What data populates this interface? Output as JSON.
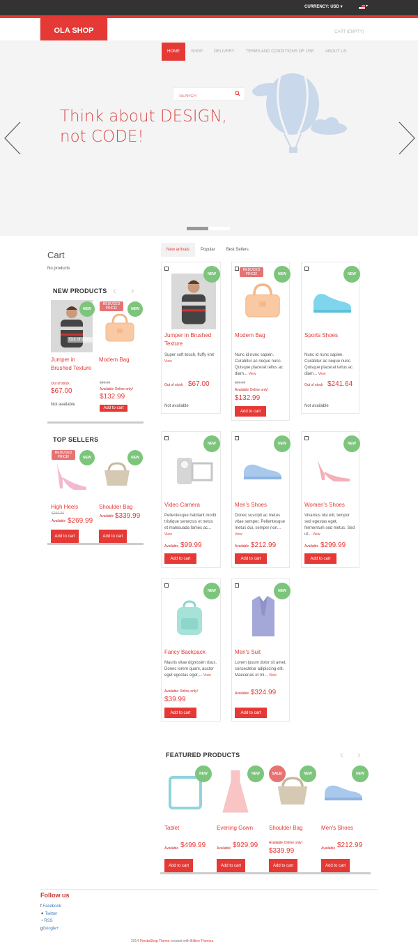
{
  "header": {
    "currency": "CURRENCY: USD",
    "logo": "OLA SHOP",
    "cart_status": "CART (EMPTY)"
  },
  "nav": {
    "items": [
      "HOME",
      "SHOP",
      "DELIVERY",
      "TERMS AND CONDITIONS OF USE",
      "ABOUT US"
    ],
    "active": "HOME"
  },
  "hero": {
    "search_placeholder": "SEARCH",
    "tagline_line1": "Think about DESIGN,",
    "tagline_line2": "not CODE!"
  },
  "sidebar": {
    "cart_title": "Cart",
    "cart_empty": "No products",
    "new_products_title": "NEW PRODUCTS",
    "new_products": [
      {
        "name": "Jumper in Brushed Texture",
        "badge": "NEW",
        "overlay": "Out of stock",
        "stock": "Out of stock",
        "price": "$67.00",
        "status": "Not available"
      },
      {
        "name": "Modern Bag",
        "badge": "NEW",
        "tag": "REDUCED PRICE!",
        "old_price": "$99.99",
        "availability": "Available Online only!",
        "price": "$132.99",
        "button": "Add to cart"
      }
    ],
    "top_sellers_title": "TOP SELLERS",
    "top_sellers": [
      {
        "name": "High Heels",
        "badge": "NEW",
        "tag": "REDUCED PRICE!",
        "old_price": "$299.99",
        "availability": "Available",
        "price": "$269.99",
        "button": "Add to cart"
      },
      {
        "name": "Shoulder Bag",
        "badge": "NEW",
        "availability": "Available",
        "price": "$339.99",
        "button": "Add to cart"
      }
    ]
  },
  "tabs": [
    "New arrivals",
    "Popular",
    "Best Sellers"
  ],
  "products": [
    {
      "name": "Jumper in Brushed Texture",
      "badge": "NEW",
      "desc": "Super soft-touch, fluffy knit",
      "view": "View",
      "stock": "Out of stock",
      "price": "$67.00",
      "status": "Not available"
    },
    {
      "name": "Modern Bag",
      "badge": "NEW",
      "tag": "REDUCED PRICE!",
      "desc": "Nunc id nunc sapien. Curabitur ac neque nunc. Quisque placerat tellus ac diam...",
      "view": "View",
      "old_price": "$99.99",
      "availability": "Available Online only!",
      "price": "$132.99",
      "button": "Add to cart"
    },
    {
      "name": "Sports Shoes",
      "badge": "NEW",
      "desc": "Nunc id nunc sapien. Curabitur ac neque nunc. Quisque placerat tellus ac diam...",
      "view": "View",
      "stock": "Out of stock",
      "price": "$241.64",
      "status": "Not available"
    },
    {
      "name": "Video Camera",
      "badge": "NEW",
      "desc": "Pellentesque habitant morbi tristique senectus et netus et malesuada fames ac...",
      "view": "View",
      "availability": "Available",
      "price": "$99.99",
      "button": "Add to cart"
    },
    {
      "name": "Men's Shoes",
      "badge": "NEW",
      "desc": "Donec suscipit ac metus vitae semper. Pellentesque metus dui, semper non...",
      "view": "View",
      "availability": "Available",
      "price": "$212.99",
      "button": "Add to cart"
    },
    {
      "name": "Women's Shoes",
      "badge": "NEW",
      "desc": "Vivamus nisi elit, tempor sed egestas eget, fermentum sed metus. Sed ut...",
      "view": "View",
      "availability": "Available",
      "price": "$299.99",
      "button": "Add to cart"
    },
    {
      "name": "Fancy Backpack",
      "badge": "NEW",
      "desc": "Mauris vitae dignissim risus. Donec lorem quam, auctor eget egestas eget,...",
      "view": "View",
      "availability": "Available Online only!",
      "price": "$39.99",
      "button": "Add to cart"
    },
    {
      "name": "Men's Suit",
      "badge": "NEW",
      "desc": "Lorem ipsum dolor sit amet, consectetur adipiscing elit. Maecenas et mi...",
      "view": "View",
      "availability": "Available",
      "price": "$324.99",
      "button": "Add to cart"
    }
  ],
  "featured": {
    "title": "FEATURED PRODUCTS",
    "items": [
      {
        "name": "Tablet",
        "badge": "NEW",
        "availability": "Available",
        "price": "$499.99",
        "button": "Add to cart"
      },
      {
        "name": "Evening Gown",
        "badge": "NEW",
        "availability": "Available",
        "price": "$929.99",
        "button": "Add to cart"
      },
      {
        "name": "Shoulder Bag",
        "badge": "NEW",
        "sale": "SALE!",
        "availability": "Available Online only!",
        "price": "$339.99",
        "button": "Add to cart"
      },
      {
        "name": "Men's Shoes",
        "badge": "NEW",
        "availability": "Available",
        "price": "$212.99",
        "button": "Add to cart"
      }
    ]
  },
  "footer": {
    "follow_title": "Follow us",
    "links": [
      "Facebook",
      "Twitter",
      "RSS",
      "Google+"
    ],
    "copy_prefix": "2014",
    "copy_theme": "PrestaShop Theme",
    "copy_mid": "created with",
    "copy_author": "Billion Themes",
    "copy_end": "."
  },
  "colors": {
    "accent": "#e53935",
    "topbar": "#333333",
    "badge_green": "#7dc57d"
  }
}
